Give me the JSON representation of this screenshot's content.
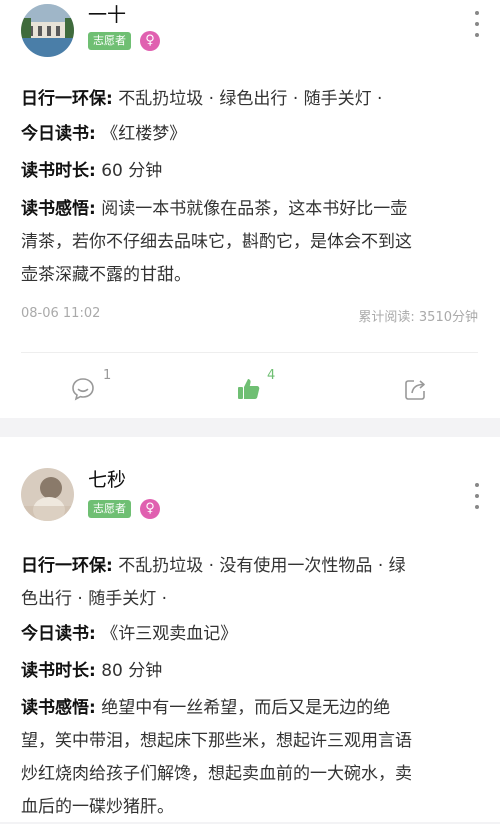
{
  "posts": [
    {
      "name": "一十",
      "badge": "志愿者",
      "gender_symbol": "♀",
      "eco_label": "日行一环保:",
      "eco_value": "不乱扔垃圾 · 绿色出行 · 随手关灯 ·",
      "book_label": "今日读书:",
      "book_value": "《红楼梦》",
      "duration_label": "读书时长:",
      "duration_value": "60 分钟",
      "insight_label": "读书感悟:",
      "insight_line1": "阅读一本书就像在品茶，这本书好比一壶",
      "insight_line2": "清茶，若你不仔细去品味它，斟酌它，是体会不到这",
      "insight_line3": "壶茶深藏不露的甘甜。",
      "time": "08-06 11:02",
      "total_reading": "累计阅读: 3510分钟",
      "comment_count": "1",
      "like_count": "4"
    },
    {
      "name": "七秒",
      "badge": "志愿者",
      "gender_symbol": "♀",
      "eco_label": "日行一环保:",
      "eco_line1": "不乱扔垃圾 · 没有使用一次性物品 · 绿",
      "eco_line2": "色出行 · 随手关灯 ·",
      "book_label": "今日读书:",
      "book_value": "《许三观卖血记》",
      "duration_label": "读书时长:",
      "duration_value": "80 分钟",
      "insight_label": "读书感悟:",
      "insight_line1": "绝望中有一丝希望，而后又是无边的绝",
      "insight_line2": "望，笑中带泪，想起床下那些米，想起许三观用言语",
      "insight_line3": "炒红烧肉给孩子们解馋，想起卖血前的一大碗水，卖",
      "insight_line4": "血后的一碟炒猪肝。"
    }
  ],
  "colors": {
    "accent_green": "#6fbf73",
    "gender_pink": "#e060b0"
  }
}
